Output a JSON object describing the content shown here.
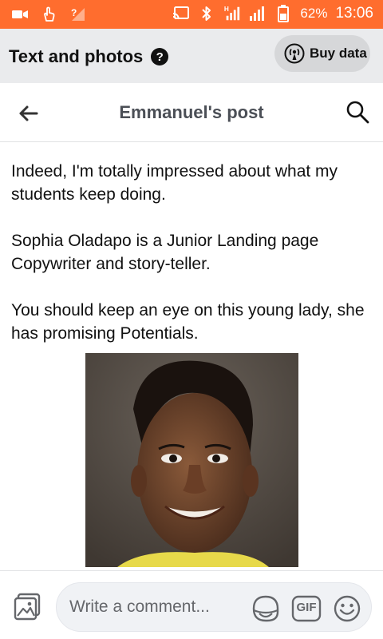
{
  "status_bar": {
    "battery": "62%",
    "time": "13:06",
    "network_label": "H"
  },
  "promo": {
    "title": "Text and photos",
    "help_icon": "?",
    "buy_label": "Buy data"
  },
  "header": {
    "title": "Emmanuel's post"
  },
  "post": {
    "paragraphs": [
      "Indeed, I'm totally impressed about what my students keep doing.",
      "Sophia Oladapo is a Junior Landing page Copywriter and  story-teller.",
      "You should keep an eye on this young lady, she has promising Potentials."
    ]
  },
  "comment": {
    "placeholder": "Write a comment...",
    "gif_label": "GIF"
  },
  "colors": {
    "status_bar": "#ff6d2e",
    "promo_bg": "#eaebed",
    "buy_button": "#d6d7d9"
  },
  "icons": {
    "status_left": [
      "video-icon",
      "hand-touch-icon",
      "no-signal-icon"
    ],
    "status_right": [
      "cast-icon",
      "bluetooth-icon",
      "signal-h-icon",
      "signal-icon",
      "battery-icon"
    ],
    "promo": [
      "help-icon",
      "broadcast-icon"
    ],
    "header": [
      "back-arrow-icon",
      "search-icon"
    ],
    "comment": [
      "photo-icon",
      "sticker-icon",
      "gif-icon",
      "emoji-icon"
    ]
  }
}
